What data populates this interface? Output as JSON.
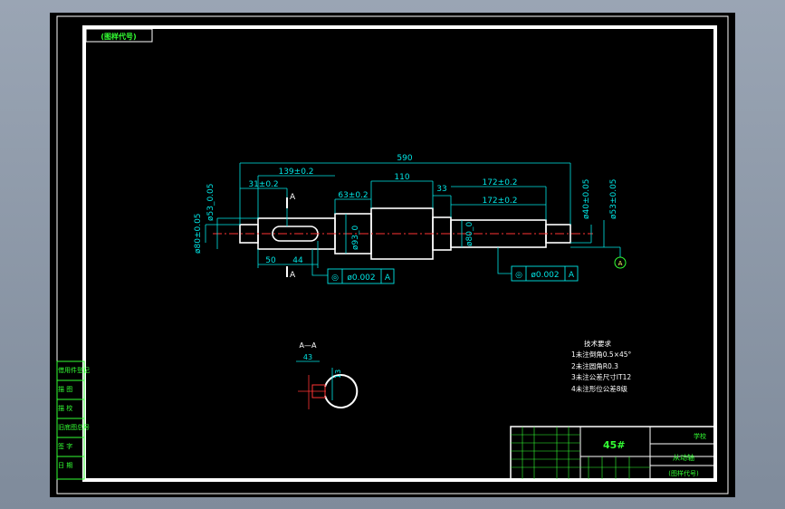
{
  "title_stamp": "(图样代号)",
  "dimensions": {
    "overall": "590",
    "d1": "139±0.2",
    "d2": "31±0.2",
    "d3": "63±0.2",
    "d4": "110",
    "d5": "33",
    "d6": "172±0.2",
    "d7": "172±0.2",
    "d8": "50",
    "d9": "44",
    "left_dia_1": "ø53_0.05",
    "left_dia_2": "ø80±0.05",
    "mid_dia_1": "ø93_0",
    "mid_dia_2": "ø80_0",
    "right_dia_1": "ø40±0.05",
    "right_dia_2": "ø53±0.05",
    "section_mark": "A",
    "datum_a": "A"
  },
  "tolerance_frames": [
    {
      "symbol": "◎",
      "value": "ø0.002",
      "datum": "A"
    },
    {
      "symbol": "◎",
      "value": "ø0.002",
      "datum": "A"
    }
  ],
  "section": {
    "label": "A—A",
    "width": "43",
    "depth": "13"
  },
  "tech_requirements": {
    "heading": "技术要求",
    "items": [
      "1未注倒角0.5×45°",
      "2未注圆角R0.3",
      "3未注公差尺寸IT12",
      "4未注形位公差8级"
    ]
  },
  "left_strip": [
    "借用件登记",
    "描 图",
    "描 校",
    "旧底图总号",
    "签 字",
    "日 期"
  ],
  "title_block": {
    "material": "45#",
    "school": "学校",
    "part_name": "从动轴",
    "drawing_no": "(图样代号)"
  },
  "colors": {
    "background": "#000000",
    "outline": "#ffffff",
    "dimension": "#00e5e5",
    "text": "#ffffff",
    "table": "#33ff33",
    "centerline": "#ff3333"
  }
}
